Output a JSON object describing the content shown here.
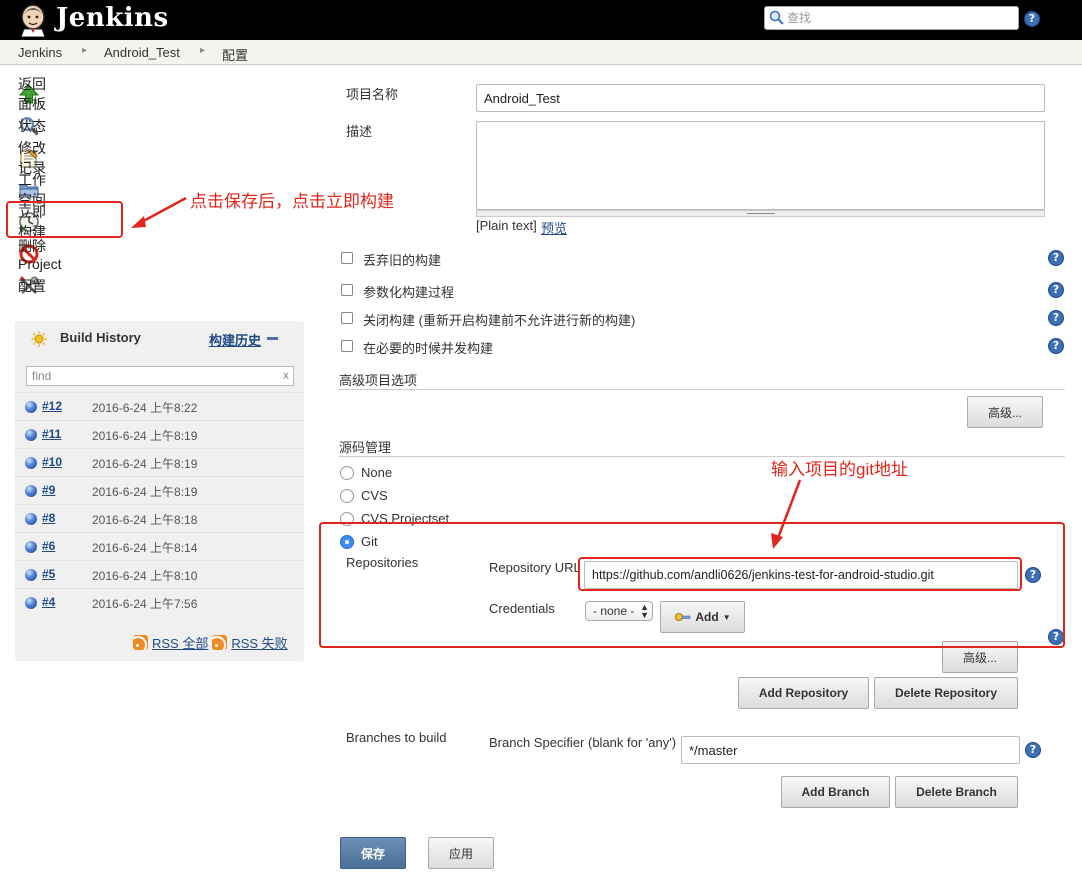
{
  "header": {
    "brand": "Jenkins",
    "search_placeholder": "查找"
  },
  "breadcrumb": [
    "Jenkins",
    "Android_Test",
    "配置"
  ],
  "sidebar": {
    "tasks": [
      {
        "label": "返回面板",
        "icon": "up-arrow-icon"
      },
      {
        "label": "状态",
        "icon": "magnifier-icon"
      },
      {
        "label": "修改记录",
        "icon": "notepad-icon"
      },
      {
        "label": "工作空间",
        "icon": "folder-icon"
      },
      {
        "label": "立即构建",
        "icon": "build-clock-icon"
      },
      {
        "label": "删除 Project",
        "icon": "no-entry-icon"
      },
      {
        "label": "配置",
        "icon": "tools-icon"
      }
    ]
  },
  "build_history": {
    "title": "Build History",
    "trend_link": "构建历史",
    "filter_placeholder": "find",
    "clear": "x",
    "builds": [
      {
        "num": "#12",
        "date": "2016-6-24 上午8:22"
      },
      {
        "num": "#11",
        "date": "2016-6-24 上午8:19"
      },
      {
        "num": "#10",
        "date": "2016-6-24 上午8:19"
      },
      {
        "num": "#9",
        "date": "2016-6-24 上午8:19"
      },
      {
        "num": "#8",
        "date": "2016-6-24 上午8:18"
      },
      {
        "num": "#6",
        "date": "2016-6-24 上午8:14"
      },
      {
        "num": "#5",
        "date": "2016-6-24 上午8:10"
      },
      {
        "num": "#4",
        "date": "2016-6-24 上午7:56"
      }
    ],
    "rss_all": "RSS 全部",
    "rss_failed": "RSS 失败"
  },
  "form": {
    "project_name_label": "项目名称",
    "project_name_value": "Android_Test",
    "description_label": "描述",
    "plain_text": "[Plain text]",
    "preview": "预览",
    "options": [
      "丢弃旧的构建",
      "参数化构建过程",
      "关闭构建 (重新开启构建前不允许进行新的构建)",
      "在必要的时候并发构建"
    ],
    "advanced_project_options": "高级项目选项",
    "advanced_button": "高级...",
    "scm_title": "源码管理",
    "scm_options": [
      "None",
      "CVS",
      "CVS Projectset",
      "Git"
    ],
    "scm_selected": "Git",
    "repositories_label": "Repositories",
    "repo_url_label": "Repository URL",
    "repo_url_value": "https://github.com/andli0626/jenkins-test-for-android-studio.git",
    "credentials_label": "Credentials",
    "credentials_value": "- none -",
    "add_button": "Add",
    "add_repository": "Add Repository",
    "delete_repository": "Delete Repository",
    "branches_label": "Branches to build",
    "branch_spec_label": "Branch Specifier (blank for 'any')",
    "branch_spec_value": "*/master",
    "add_branch": "Add Branch",
    "delete_branch": "Delete Branch",
    "save": "保存",
    "apply": "应用"
  },
  "annotations": {
    "build_now_note": "点击保存后，点击立即构建",
    "git_url_note": "输入项目的git地址",
    "color": "#e0261d"
  }
}
